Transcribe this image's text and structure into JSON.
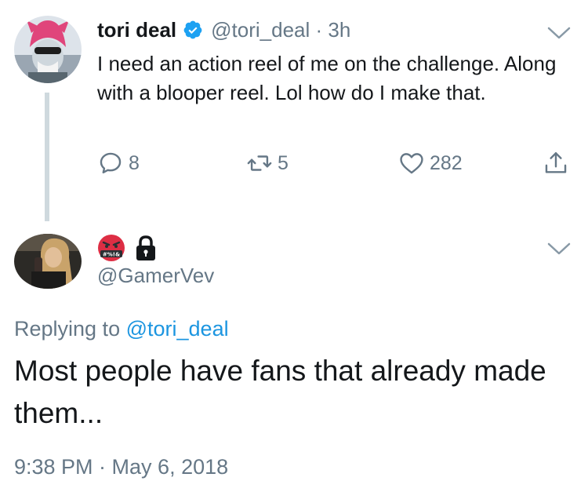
{
  "tweet": {
    "author_name": "tori deal",
    "verified": true,
    "handle": "@tori_deal",
    "separator": "·",
    "time_ago": "3h",
    "text": "I need an action reel of me on the challenge. Along with a blooper reel. Lol how do I make that.",
    "reply_count": "8",
    "retweet_count": "5",
    "like_count": "282",
    "icons": [
      "reply-icon",
      "retweet-icon",
      "like-icon",
      "share-icon",
      "chevron-down-icon",
      "verified-badge-icon"
    ]
  },
  "reply": {
    "display_name_emoji": [
      "angry-cursing-face-icon",
      "lock-icon"
    ],
    "handle": "@GamerVev",
    "replying_prefix": "Replying to",
    "replying_to": "@tori_deal",
    "text": "Most people have fans that already made them...",
    "timestamp": "9:38 PM · May 6, 2018"
  },
  "colors": {
    "primary_text": "#14171a",
    "secondary_text": "#657786",
    "link": "#1b95e0",
    "verified": "#1da1f2",
    "thread_line": "#cfd9de"
  }
}
